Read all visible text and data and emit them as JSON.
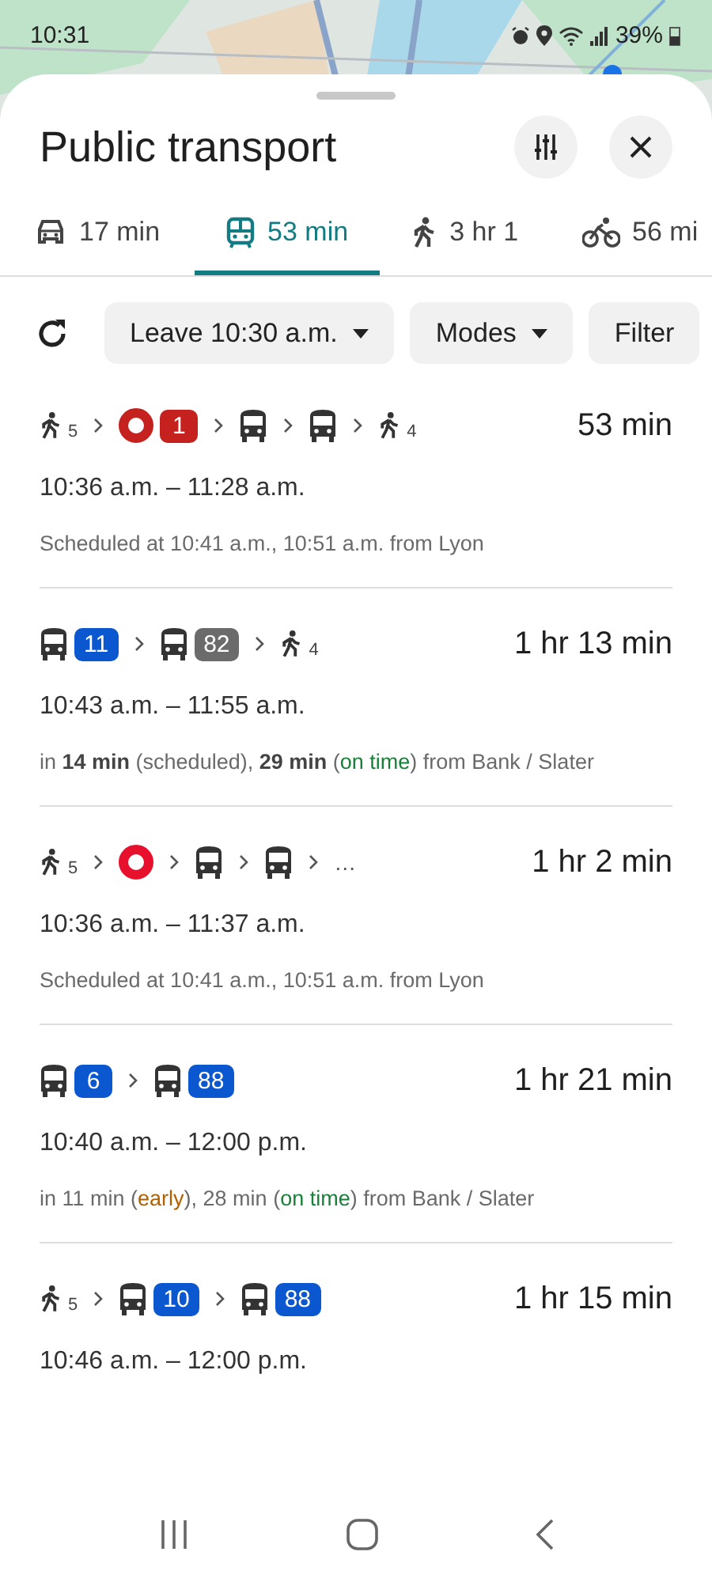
{
  "status_bar": {
    "time": "10:31",
    "battery": "39%"
  },
  "sheet": {
    "title": "Public transport"
  },
  "tabs": [
    {
      "kind": "car",
      "label": "17 min",
      "selected": false
    },
    {
      "kind": "transit",
      "label": "53 min",
      "selected": true
    },
    {
      "kind": "walk",
      "label": "3 hr 1",
      "selected": false
    },
    {
      "kind": "bike",
      "label": "56 mi",
      "selected": false
    }
  ],
  "chips": [
    {
      "label": "Leave 10:30 a.m.",
      "dropdown": true
    },
    {
      "label": "Modes",
      "dropdown": true
    },
    {
      "label": "Filter",
      "dropdown": false
    }
  ],
  "routes": [
    {
      "legs": [
        {
          "kind": "walk",
          "minutes": "5"
        },
        {
          "kind": "rail",
          "line": "1",
          "color": "#c5221f"
        },
        {
          "kind": "bus"
        },
        {
          "kind": "bus"
        },
        {
          "kind": "walk",
          "minutes": "4"
        }
      ],
      "duration": "53 min",
      "times": "10:36 a.m. – 11:28 a.m.",
      "details": [
        {
          "kind": "plain",
          "text": "Scheduled at 10:41 a.m., 10:51 a.m. from Lyon"
        }
      ]
    },
    {
      "legs": [
        {
          "kind": "bus",
          "line": "11",
          "color": "#0b57d0"
        },
        {
          "kind": "bus",
          "line": "82",
          "color": "#6b6b6b"
        },
        {
          "kind": "walk",
          "minutes": "4"
        }
      ],
      "duration": "1 hr 13 min",
      "times": "10:43 a.m. – 11:55 a.m.",
      "details": [
        {
          "kind": "plain",
          "text": "in "
        },
        {
          "kind": "bold",
          "text": "14 min"
        },
        {
          "kind": "plain",
          "text": " (scheduled), "
        },
        {
          "kind": "bold",
          "text": "29 min"
        },
        {
          "kind": "plain",
          "text": " ("
        },
        {
          "kind": "on_time",
          "text": "on time"
        },
        {
          "kind": "plain",
          "text": ") from Bank / Slater"
        }
      ]
    },
    {
      "legs": [
        {
          "kind": "walk",
          "minutes": "5"
        },
        {
          "kind": "rail",
          "color": "#e8112d"
        },
        {
          "kind": "bus"
        },
        {
          "kind": "bus"
        },
        {
          "kind": "more",
          "text": "…"
        }
      ],
      "duration": "1 hr 2 min",
      "times": "10:36 a.m. – 11:37 a.m.",
      "details": [
        {
          "kind": "plain",
          "text": "Scheduled at 10:41 a.m., 10:51 a.m. from Lyon"
        }
      ]
    },
    {
      "legs": [
        {
          "kind": "bus",
          "line": "6",
          "color": "#0b57d0"
        },
        {
          "kind": "bus",
          "line": "88",
          "color": "#0b57d0"
        }
      ],
      "duration": "1 hr 21 min",
      "times": "10:40 a.m. – 12:00 p.m.",
      "details": [
        {
          "kind": "plain",
          "text": "in 11 min ("
        },
        {
          "kind": "early",
          "text": "early"
        },
        {
          "kind": "plain",
          "text": "), 28 min ("
        },
        {
          "kind": "on_time",
          "text": "on time"
        },
        {
          "kind": "plain",
          "text": ") from Bank / Slater"
        }
      ]
    },
    {
      "legs": [
        {
          "kind": "walk",
          "minutes": "5"
        },
        {
          "kind": "bus",
          "line": "10",
          "color": "#0b57d0"
        },
        {
          "kind": "bus",
          "line": "88",
          "color": "#0b57d0"
        }
      ],
      "duration": "1 hr 15 min",
      "times": "10:46 a.m. – 12:00 p.m."
    }
  ]
}
